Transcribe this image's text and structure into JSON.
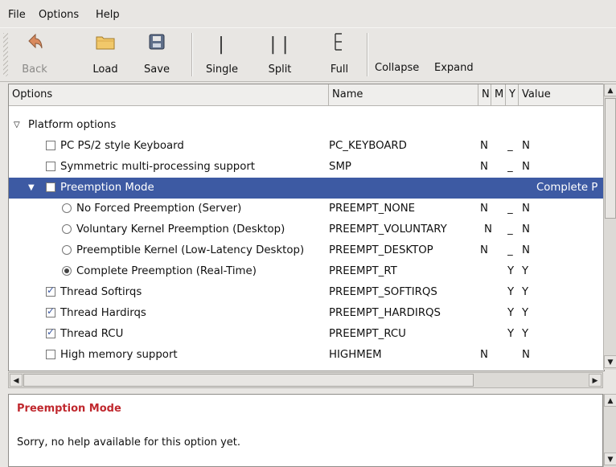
{
  "menubar": {
    "items": [
      {
        "label": "File"
      },
      {
        "label": "Options"
      },
      {
        "label": "Help"
      }
    ]
  },
  "toolbar": {
    "back_label": "Back",
    "load_label": "Load",
    "save_label": "Save",
    "single_label": "Single",
    "split_label": "Split",
    "full_label": "Full",
    "collapse_label": "Collapse",
    "expand_label": "Expand"
  },
  "columns": {
    "options": "Options",
    "name": "Name",
    "n": "N",
    "m": "M",
    "y": "Y",
    "value": "Value"
  },
  "rows": [
    {
      "label": "Platform options",
      "name": "",
      "n": "",
      "m": "",
      "y": "",
      "value": ""
    },
    {
      "label": "PC PS/2 style Keyboard",
      "name": "PC_KEYBOARD",
      "n": "N",
      "m": "",
      "y": "_",
      "value": "N"
    },
    {
      "label": "Symmetric multi-processing support",
      "name": "SMP",
      "n": "N",
      "m": "",
      "y": "_",
      "value": "N"
    },
    {
      "label": "Preemption Mode",
      "name": "",
      "n": "",
      "m": "",
      "y": "",
      "value": "Complete P"
    },
    {
      "label": "No Forced Preemption (Server)",
      "name": "PREEMPT_NONE",
      "n": "N",
      "m": "",
      "y": "_",
      "value": "N"
    },
    {
      "label": "Voluntary Kernel Preemption (Desktop)",
      "name": "PREEMPT_VOLUNTARY",
      "n": "N",
      "m": "",
      "y": "_",
      "value": "N"
    },
    {
      "label": "Preemptible Kernel (Low-Latency Desktop)",
      "name": "PREEMPT_DESKTOP",
      "n": "N",
      "m": "",
      "y": "_",
      "value": "N"
    },
    {
      "label": "Complete Preemption (Real-Time)",
      "name": "PREEMPT_RT",
      "n": "",
      "m": "",
      "y": "Y",
      "value": "Y"
    },
    {
      "label": "Thread Softirqs",
      "name": "PREEMPT_SOFTIRQS",
      "n": "",
      "m": "",
      "y": "Y",
      "value": "Y"
    },
    {
      "label": "Thread Hardirqs",
      "name": "PREEMPT_HARDIRQS",
      "n": "",
      "m": "",
      "y": "Y",
      "value": "Y"
    },
    {
      "label": "Thread RCU",
      "name": "PREEMPT_RCU",
      "n": "",
      "m": "",
      "y": "Y",
      "value": "Y"
    },
    {
      "label": "High memory support",
      "name": "HIGHMEM",
      "n": "N",
      "m": "",
      "y": "",
      "value": "N"
    }
  ],
  "help": {
    "title": "Preemption Mode",
    "text": "Sorry, no help available for this option yet."
  },
  "colors": {
    "selection": "#3d5aa3",
    "help_title": "#c0282e"
  }
}
